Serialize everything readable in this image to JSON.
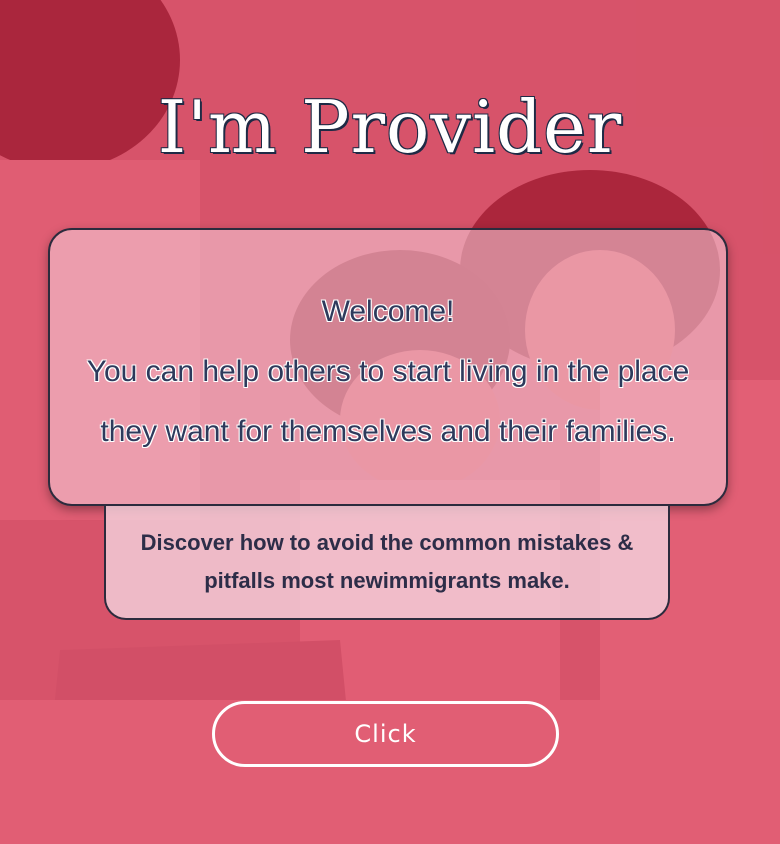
{
  "hero": {
    "title": "I'm Provider",
    "welcome_lines": [
      "Welcome!",
      "You can help others to start living in the place",
      "they want for themselves and their families."
    ],
    "discover_text": "Discover how to avoid the common mistakes & pitfalls most newimmigrants make.",
    "button_label": "Click"
  },
  "colors": {
    "overlay": "#dc2846",
    "title_text": "#ffffff",
    "welcome_text": "#2e3a5c",
    "card_border": "#2c2b3d",
    "button_border": "#ffffff"
  }
}
